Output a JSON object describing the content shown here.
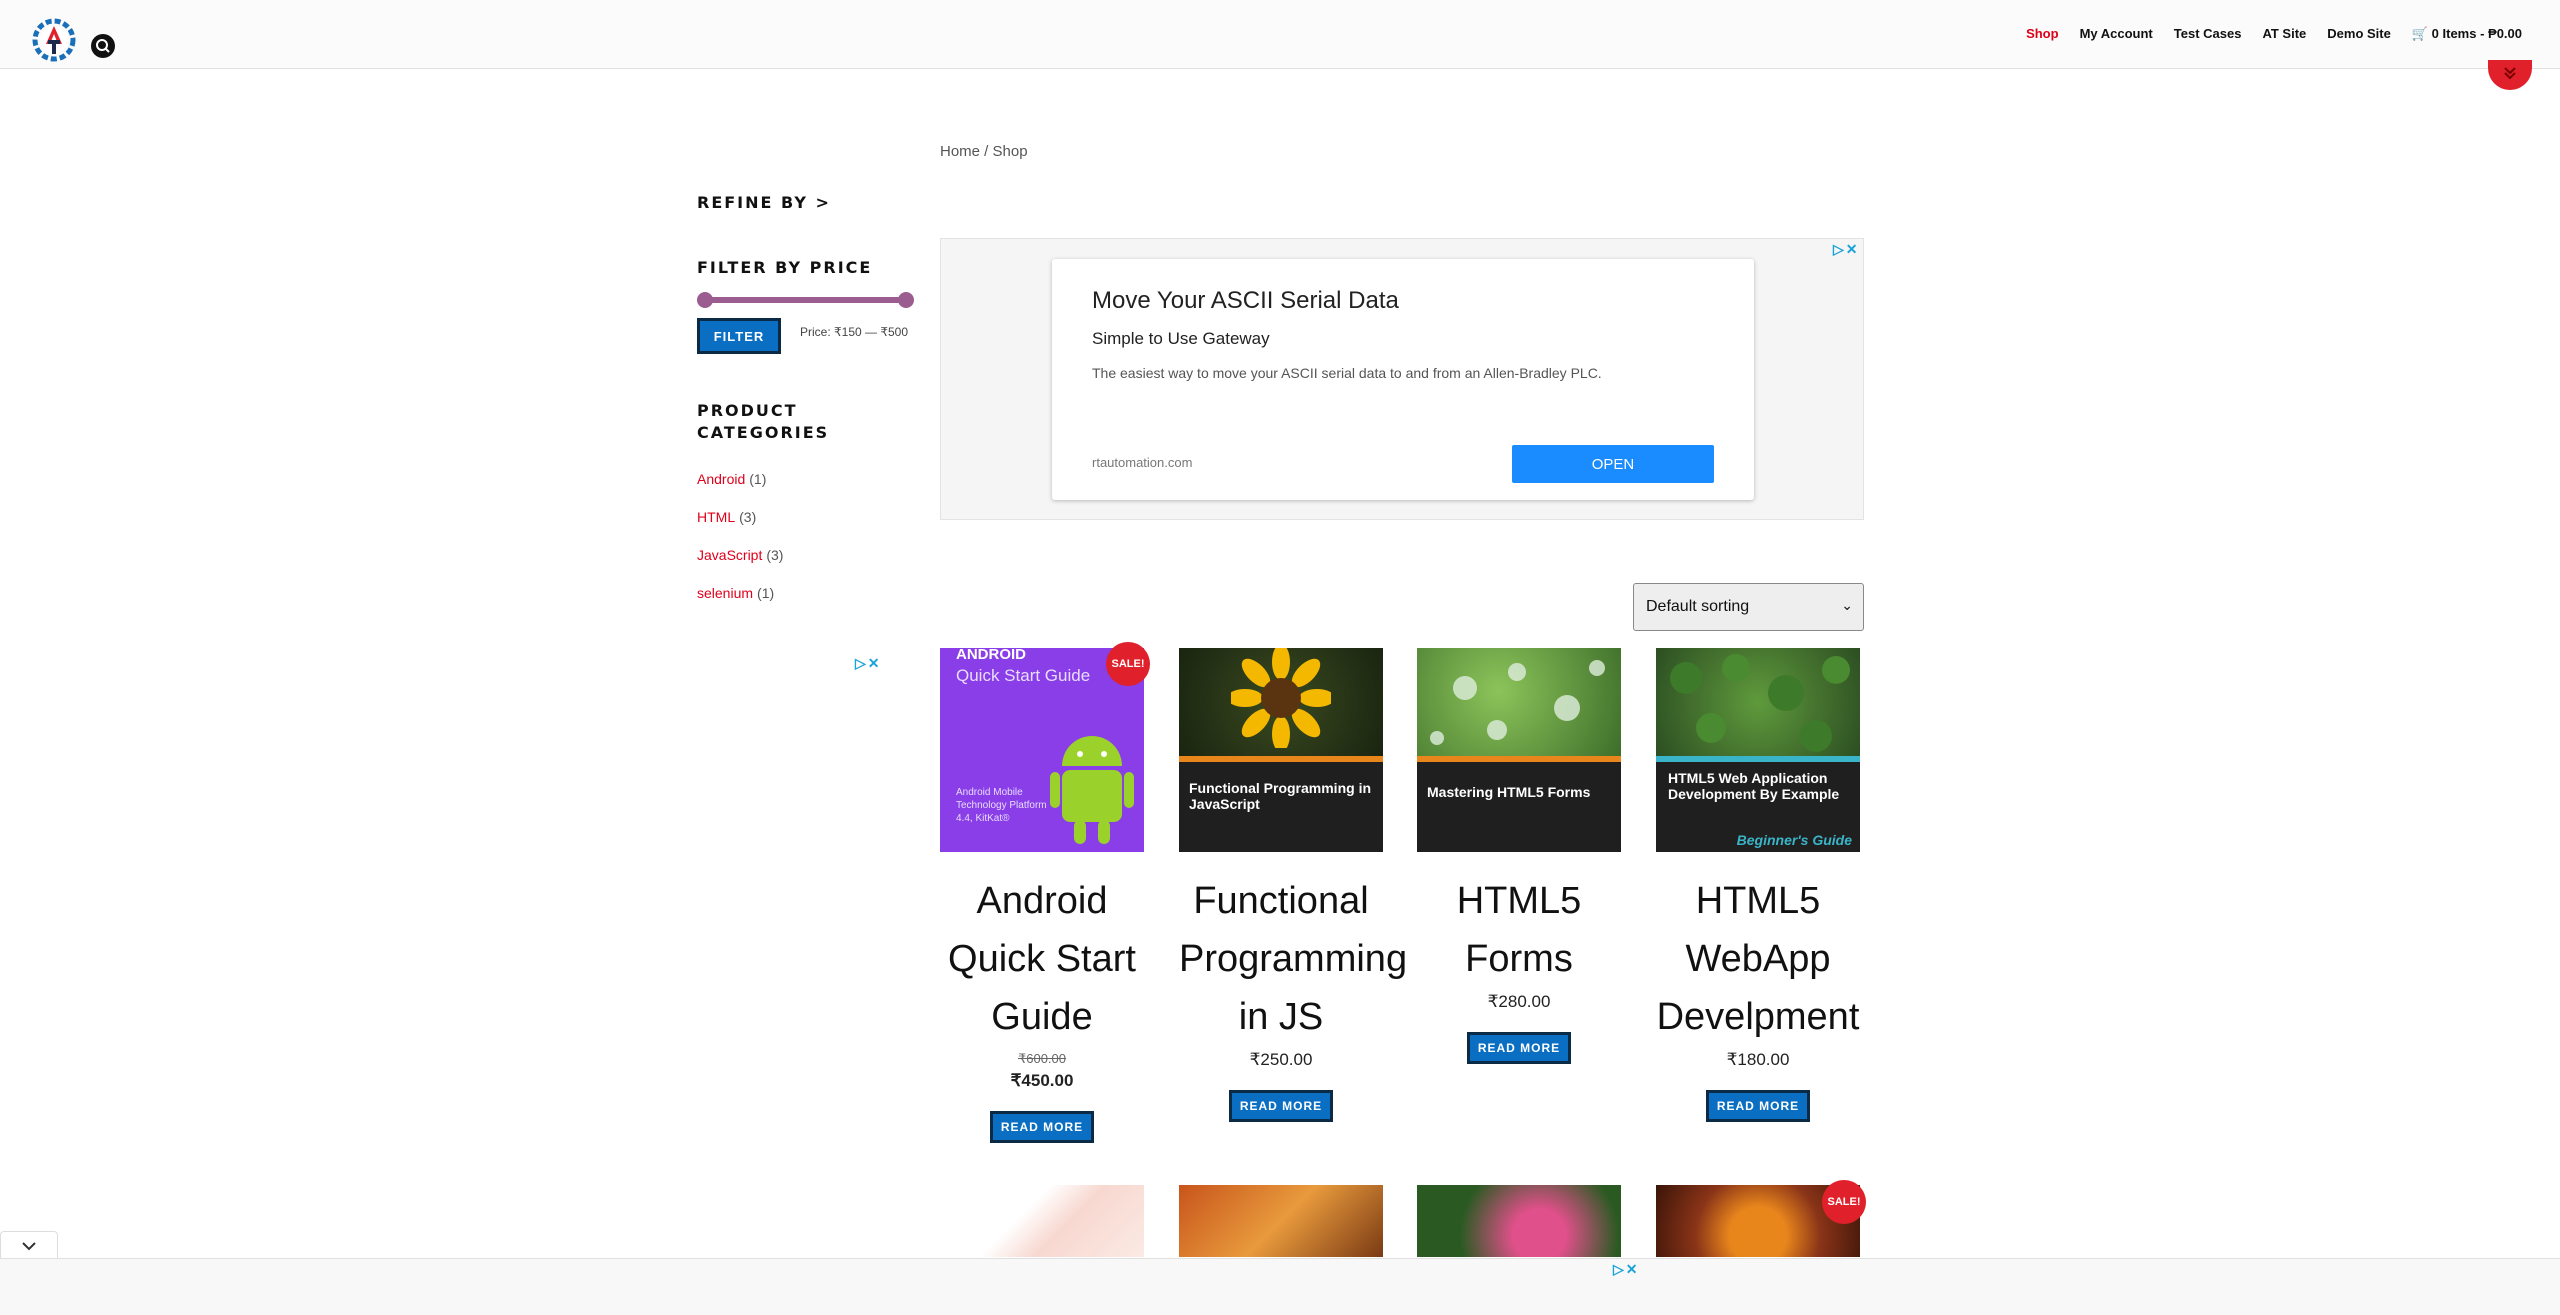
{
  "nav": {
    "shop": "Shop",
    "my_account": "My Account",
    "test_cases": "Test Cases",
    "at_site": "AT Site",
    "demo_site": "Demo Site",
    "cart": "0 Items - ₱0.00"
  },
  "breadcrumb": {
    "home": "Home",
    "sep": " / ",
    "current": "Shop"
  },
  "sidebar": {
    "refine_title": "REFINE BY >",
    "filter_title": "FILTER BY PRICE",
    "filter_button": "FILTER",
    "price_label": "Price: ₹150 — ₹500",
    "categories_title": "PRODUCT CATEGORIES",
    "categories": [
      {
        "name": "Android",
        "count": "(1)"
      },
      {
        "name": "HTML",
        "count": "(3)"
      },
      {
        "name": "JavaScript",
        "count": "(3)"
      },
      {
        "name": "selenium",
        "count": "(1)"
      }
    ]
  },
  "ad": {
    "title": "Move Your ASCII Serial Data",
    "subtitle": "Simple to Use Gateway",
    "description": "The easiest way to move your ASCII serial data to and from an Allen-Bradley PLC.",
    "domain": "rtautomation.com",
    "open_label": "OPEN"
  },
  "sorting": {
    "selected": "Default sorting"
  },
  "products": [
    {
      "name": "Android Quick Start Guide",
      "old_price": "₹600.00",
      "price": "₹450.00",
      "sale": "SALE!",
      "button": "READ MORE",
      "cover_title": "ANDROID",
      "cover_sub": "Quick Start Guide",
      "cover_meta": "Android Mobile Technology Platform 4.4, KitKat®"
    },
    {
      "name": "Functional Programming in JS",
      "price": "₹250.00",
      "button": "READ MORE",
      "cover_title": "Functional Programming in JavaScript"
    },
    {
      "name": "HTML5 Forms",
      "price": "₹280.00",
      "button": "READ MORE",
      "cover_title": "Mastering HTML5 Forms"
    },
    {
      "name": "HTML5 WebApp Develpment",
      "price": "₹180.00",
      "button": "READ MORE",
      "cover_title": "HTML5 Web Application Development By Example",
      "cover_sub": "Beginner's Guide"
    }
  ],
  "bottom_sale": "SALE!",
  "colors": {
    "accent_red": "#e0001b",
    "button_blue": "#0a6fc2",
    "slider_purple": "#9b5c8f"
  }
}
